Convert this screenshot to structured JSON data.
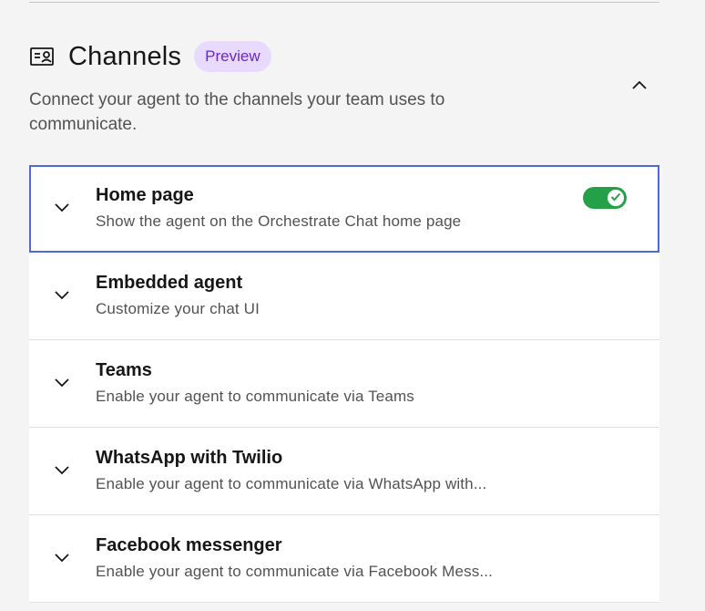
{
  "section": {
    "icon": "contact-card-icon",
    "title": "Channels",
    "tag": "Preview",
    "description": "Connect your agent to the channels your team uses to communicate.",
    "collapse_icon": "chevron-up-icon",
    "tag_colors": {
      "background": "#e8daff",
      "text": "#6929c4"
    }
  },
  "channels": [
    {
      "title": "Home page",
      "subtitle": "Show the agent on the Orchestrate Chat home page",
      "expand_icon": "chevron-down-icon",
      "focused": true,
      "toggle": {
        "on": true,
        "icon": "checkmark-icon",
        "color": "#24a148"
      }
    },
    {
      "title": "Embedded agent",
      "subtitle": "Customize your chat UI",
      "expand_icon": "chevron-down-icon"
    },
    {
      "title": "Teams",
      "subtitle": "Enable your agent to communicate via Teams",
      "expand_icon": "chevron-down-icon"
    },
    {
      "title": "WhatsApp with Twilio",
      "subtitle": "Enable your agent to communicate via WhatsApp with...",
      "expand_icon": "chevron-down-icon"
    },
    {
      "title": "Facebook messenger",
      "subtitle": "Enable your agent to communicate via Facebook Mess...",
      "expand_icon": "chevron-down-icon"
    }
  ],
  "colors": {
    "focus_border": "#4f6ad8",
    "background": "#f4f4f4",
    "row_background": "#ffffff"
  }
}
